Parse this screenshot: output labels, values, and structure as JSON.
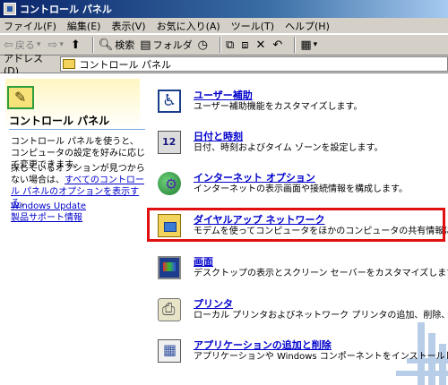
{
  "window": {
    "title": "コントロール パネル"
  },
  "menu": [
    "ファイル(F)",
    "編集(E)",
    "表示(V)",
    "お気に入り(A)",
    "ツール(T)",
    "ヘルプ(H)"
  ],
  "toolbar": {
    "back": "戻る",
    "search": "検索",
    "folders": "フォルダ"
  },
  "address": {
    "label": "アドレス(D)",
    "value": "コントロール パネル"
  },
  "left": {
    "title": "コントロール パネル",
    "desc": "コントロール パネルを使うと、コンピュータの設定を好みに応じて変更できます。",
    "hint_prefix": "探しているオプションが見つからない場合は、",
    "hint_link": "すべてのコントロール パネルのオプションを表示する",
    "hint_suffix": "。",
    "link1": "Windows Update",
    "link2": "製品サポート情報"
  },
  "items": [
    {
      "title": "ユーザー補助",
      "desc": "ユーザー補助機能をカスタマイズします。",
      "icon": "accessibility-icon"
    },
    {
      "title": "日付と時刻",
      "desc": "日付、時刻およびタイム ゾーンを設定します。",
      "icon": "date-time-icon"
    },
    {
      "title": "インターネット オプション",
      "desc": "インターネットの表示画面や接続情報を構成します。",
      "icon": "internet-options-icon"
    },
    {
      "title": "ダイヤルアップ ネットワーク",
      "desc": "モデムを使ってコンピュータをほかのコンピュータの共有情報に接続します。",
      "icon": "dialup-network-icon"
    },
    {
      "title": "画面",
      "desc": "デスクトップの表示とスクリーン セーバーをカスタマイズします。",
      "icon": "display-icon"
    },
    {
      "title": "プリンタ",
      "desc": "ローカル プリンタおよびネットワーク プリンタの追加、削除、構成を行います。",
      "icon": "printer-icon"
    },
    {
      "title": "アプリケーションの追加と削除",
      "desc": "アプリケーションや Windows コンポーネントをインストールしたり、削除したりします。",
      "icon": "add-remove-programs-icon"
    }
  ],
  "colors": {
    "highlight": "#e01010",
    "link": "#0000cc"
  }
}
